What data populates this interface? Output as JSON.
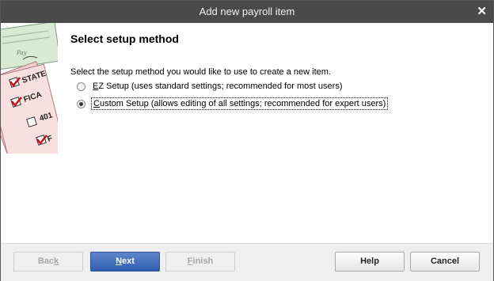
{
  "window": {
    "title": "Add new payroll item"
  },
  "page": {
    "heading": "Select setup method",
    "instruction": "Select the setup method you would like to use to create a new item."
  },
  "options": [
    {
      "key": "E",
      "rest": "Z Setup (uses standard settings; recommended for most users)",
      "selected": false
    },
    {
      "key": "C",
      "rest": "ustom Setup (allows editing of all settings; recommended for expert users)",
      "selected": true
    }
  ],
  "art": {
    "labels": [
      "STATE",
      "FICA",
      "401",
      "F"
    ],
    "check_text": "Pay"
  },
  "buttons": {
    "back": {
      "pre": "Bac",
      "key": "k",
      "post": ""
    },
    "next": {
      "pre": "",
      "key": "N",
      "post": "ext"
    },
    "finish": {
      "pre": "",
      "key": "F",
      "post": "inish"
    },
    "help": "Help",
    "cancel": "Cancel"
  }
}
